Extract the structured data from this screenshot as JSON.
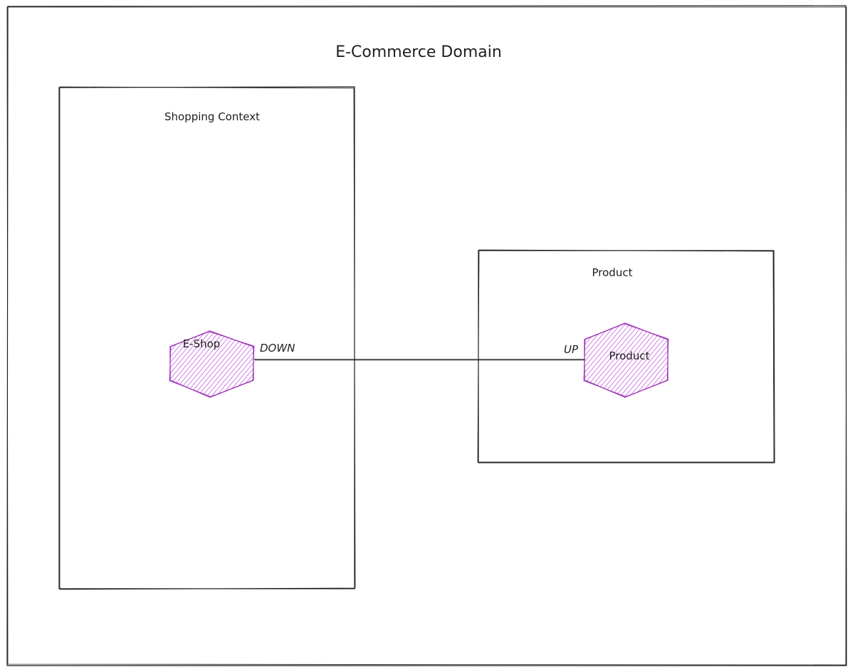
{
  "domain": {
    "title": "E-Commerce Domain"
  },
  "contexts": [
    {
      "id": "shopping",
      "label": "Shopping Context"
    },
    {
      "id": "product",
      "label": "Product"
    }
  ],
  "nodes": [
    {
      "id": "eshop",
      "label": "E-Shop",
      "context": "shopping"
    },
    {
      "id": "product-node",
      "label": "Product",
      "context": "product"
    }
  ],
  "relation": {
    "from": "eshop",
    "to": "product-node",
    "from_label": "DOWN",
    "to_label": "UP"
  },
  "colors": {
    "stroke": "#1e1e1e",
    "node_stroke": "#9c36b5",
    "node_hatch": "#be4bdb",
    "background": "#ffffff"
  }
}
